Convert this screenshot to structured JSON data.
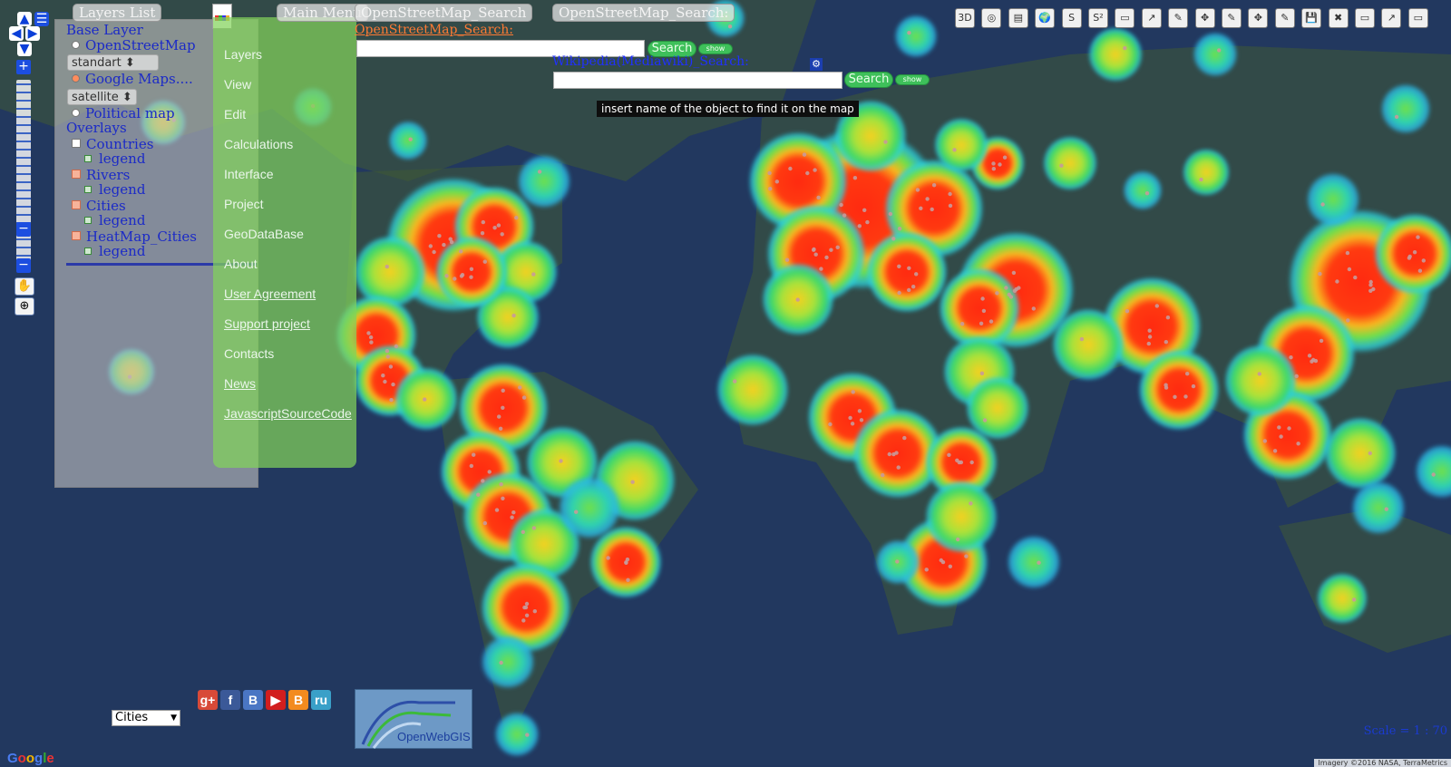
{
  "map": {
    "ocean_color": "#22385f",
    "land_color": "#3f5a35",
    "heat_colors": {
      "low": "#2bd0e0",
      "mid": "#6fe04a",
      "high": "#f2c21a",
      "max": "#ff2a10"
    }
  },
  "nav": {
    "up": "▲",
    "down": "▼",
    "left": "◀",
    "right": "▶",
    "zoom_in": "+",
    "zoom_out": "−",
    "layers_glyph": "☰"
  },
  "layers_panel": {
    "tab_label": "Layers List",
    "base_layer_title": "Base Layer",
    "base_layers": [
      {
        "label": "OpenStreetMap",
        "selected": false,
        "select_value": "standart"
      },
      {
        "label": "Google Maps....",
        "selected": true,
        "select_value": "satellite"
      },
      {
        "label": "Political map",
        "selected": false
      }
    ],
    "overlays_title": "Overlays",
    "overlays": [
      {
        "label": "Countries",
        "checked": false,
        "legend": "legend"
      },
      {
        "label": "Rivers",
        "checked": true,
        "legend": "legend"
      },
      {
        "label": "Cities",
        "checked": true,
        "legend": "legend"
      },
      {
        "label": "HeatMap_Cities",
        "checked": true,
        "legend": "legend"
      }
    ]
  },
  "main_menu": {
    "tab_label": "Main Menu",
    "items": [
      "Layers",
      "View",
      "Edit",
      "Calculations",
      "Interface",
      "Project",
      "GeoDataBase",
      "About",
      "User Agreement",
      "Support project",
      "Contacts",
      "News",
      "JavascriptSourceCode"
    ]
  },
  "osm_search": {
    "tab_label": "OpenStreetMap_Search",
    "tab_label_2": "OpenStreetMap_Search:",
    "link": "OpenStreetMap_Search:",
    "input_value": "",
    "button": "Search",
    "show": "show"
  },
  "wiki_search": {
    "label": "Wikipedia(Mediawiki)_Search:",
    "input_value": "",
    "button": "Search",
    "show": "show",
    "tooltip": "insert name of the object to find it on the map"
  },
  "toolbar": {
    "tools": [
      "3D",
      "◎",
      "▤",
      "🌍",
      "S",
      "S²",
      "▭",
      "↗",
      "✎",
      "✥",
      "✎",
      "✥",
      "✎",
      "💾",
      "✖",
      "▭",
      "↗",
      "▭"
    ]
  },
  "bottom": {
    "cities_select": "Cities",
    "social": [
      "g+",
      "f",
      "B",
      "▶",
      "B",
      "ru"
    ],
    "logo_text": "OpenWebGIS",
    "scale_text": "Scale = 1 : 70",
    "attribution": "Imagery ©2016 NASA, TerraMetrics",
    "google": "Google"
  }
}
